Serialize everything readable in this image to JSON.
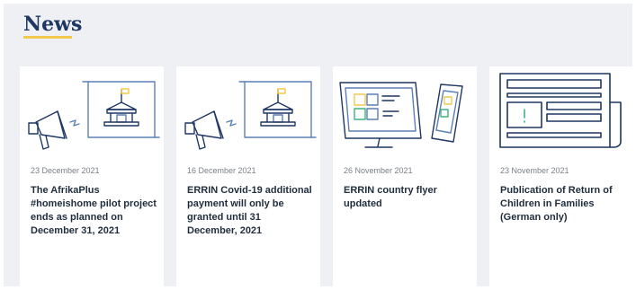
{
  "section": {
    "title": "News"
  },
  "colors": {
    "navy": "#1f3763",
    "accent": "#f2c94c",
    "icon_blue": "#5b7fb8",
    "icon_green": "#3fb37f",
    "icon_yellow": "#f2c94c"
  },
  "cards": [
    {
      "date": "23 December 2021",
      "title": "The AfrikaPlus #homeishome pilot project ends as planned on December 31, 2021",
      "illustration": "megaphone-building-icon"
    },
    {
      "date": "16 December 2021",
      "title": "ERRIN Covid-19 additional payment will only be granted until 31 December, 2021",
      "illustration": "megaphone-building-icon"
    },
    {
      "date": "26 November 2021",
      "title": "ERRIN country flyer updated",
      "illustration": "monitor-phone-icon"
    },
    {
      "date": "23 November 2021",
      "title": "Publication of Return of Children in Families (German only)",
      "illustration": "newspaper-icon"
    }
  ]
}
